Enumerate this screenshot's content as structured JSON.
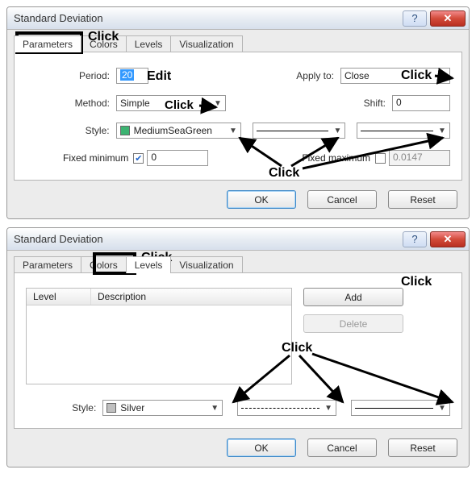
{
  "dialog1": {
    "title": "Standard Deviation",
    "tabs": [
      "Parameters",
      "Colors",
      "Levels",
      "Visualization"
    ],
    "period_label": "Period:",
    "period_value": "20",
    "applyto_label": "Apply to:",
    "applyto_value": "Close",
    "method_label": "Method:",
    "method_value": "Simple",
    "shift_label": "Shift:",
    "shift_value": "0",
    "style_label": "Style:",
    "style_color_name": "MediumSeaGreen",
    "fixedmin_label": "Fixed minimum",
    "fixedmin_value": "0",
    "fixedmax_label": "Fixed maximum",
    "fixedmax_value": "0.0147",
    "ok": "OK",
    "cancel": "Cancel",
    "reset": "Reset"
  },
  "dialog2": {
    "title": "Standard Deviation",
    "tabs": [
      "Parameters",
      "Colors",
      "Levels",
      "Visualization"
    ],
    "level_col": "Level",
    "desc_col": "Description",
    "add": "Add",
    "delete": "Delete",
    "style_label": "Style:",
    "style_color_name": "Silver",
    "ok": "OK",
    "cancel": "Cancel",
    "reset": "Reset"
  },
  "annots": {
    "click": "Click",
    "edit": "Edit"
  }
}
